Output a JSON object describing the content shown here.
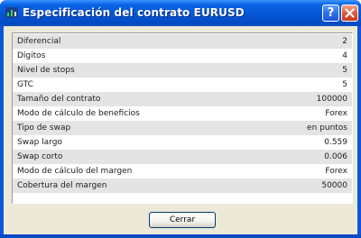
{
  "window": {
    "title": "Especificación del contrato EURUSD",
    "help_label": "?",
    "close_icon": "close-x-icon",
    "app_icon": "chart-app-icon"
  },
  "spec_rows": [
    {
      "label": "Diferencial",
      "value": "2"
    },
    {
      "label": "Dígitos",
      "value": "4"
    },
    {
      "label": "Nivel de stops",
      "value": "5"
    },
    {
      "label": "GTC",
      "value": "5"
    },
    {
      "label": "Tamaño del contrato",
      "value": "100000"
    },
    {
      "label": "Modo de cálculo de beneficios",
      "value": "Forex"
    },
    {
      "label": "Tipo de swap",
      "value": "en puntos"
    },
    {
      "label": "Swap largo",
      "value": "0.559"
    },
    {
      "label": "Swap corto",
      "value": "0.006"
    },
    {
      "label": "Modo de cálculo del margen",
      "value": "Forex"
    },
    {
      "label": "Cobertura del margen",
      "value": "50000"
    }
  ],
  "buttons": {
    "close_label": "Cerrar"
  },
  "colors": {
    "title_bar": "#0456d6",
    "row_shade": "#e4e4e4",
    "face": "#ece9d8"
  }
}
